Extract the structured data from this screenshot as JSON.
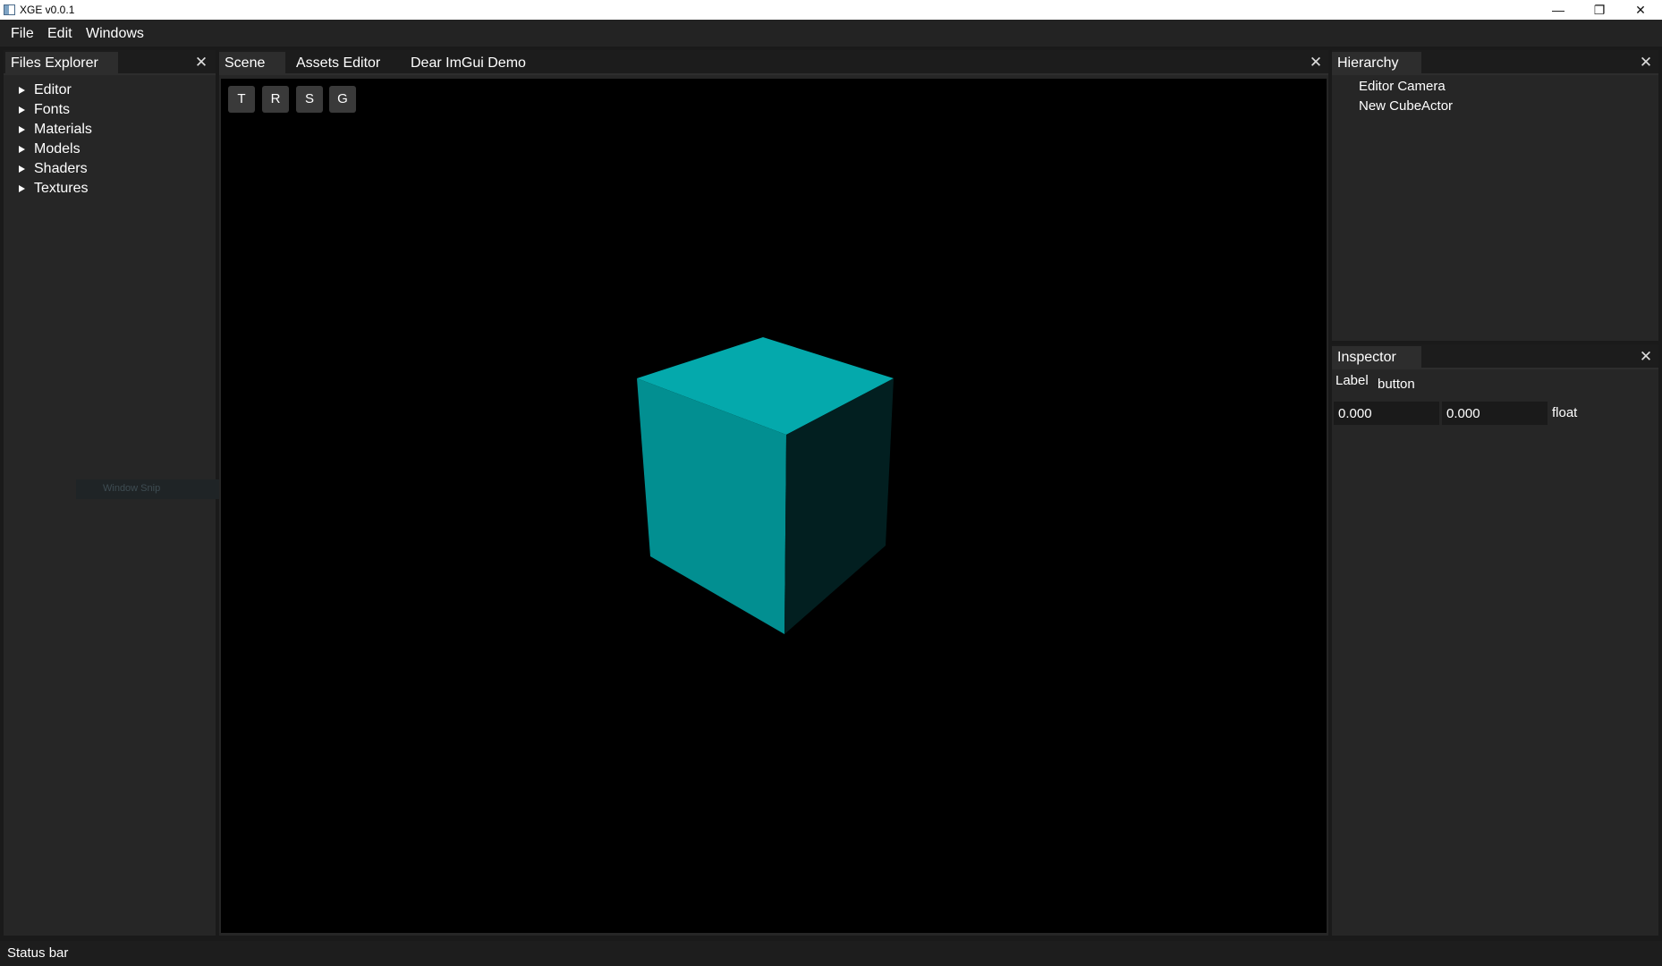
{
  "window": {
    "title": "XGE v0.0.1",
    "minimize_glyph": "—",
    "maximize_glyph": "❐",
    "close_glyph": "✕"
  },
  "menu": {
    "items": [
      "File",
      "Edit",
      "Windows"
    ]
  },
  "files_explorer": {
    "title": "Files Explorer",
    "close_glyph": "✕",
    "folders": [
      "Editor",
      "Fonts",
      "Materials",
      "Models",
      "Shaders",
      "Textures"
    ]
  },
  "drag_ghost": {
    "label": "Window Snip"
  },
  "center": {
    "tabs": [
      "Scene",
      "Assets Editor",
      "Dear ImGui Demo"
    ],
    "active_tab": "Scene",
    "close_glyph": "✕",
    "gizmo_buttons": [
      "T",
      "R",
      "S",
      "G"
    ],
    "cube_colors": {
      "top": "#04a9ac",
      "left": "#028f91",
      "right": "#021f20"
    }
  },
  "hierarchy": {
    "title": "Hierarchy",
    "close_glyph": "✕",
    "items": [
      "Editor Camera",
      "New CubeActor"
    ]
  },
  "inspector": {
    "title": "Inspector",
    "close_glyph": "✕",
    "label": "Label",
    "button_label": "button",
    "float_values": [
      "0.000",
      "0.000"
    ],
    "float_suffix": "float"
  },
  "status_bar": {
    "text": "Status bar"
  }
}
